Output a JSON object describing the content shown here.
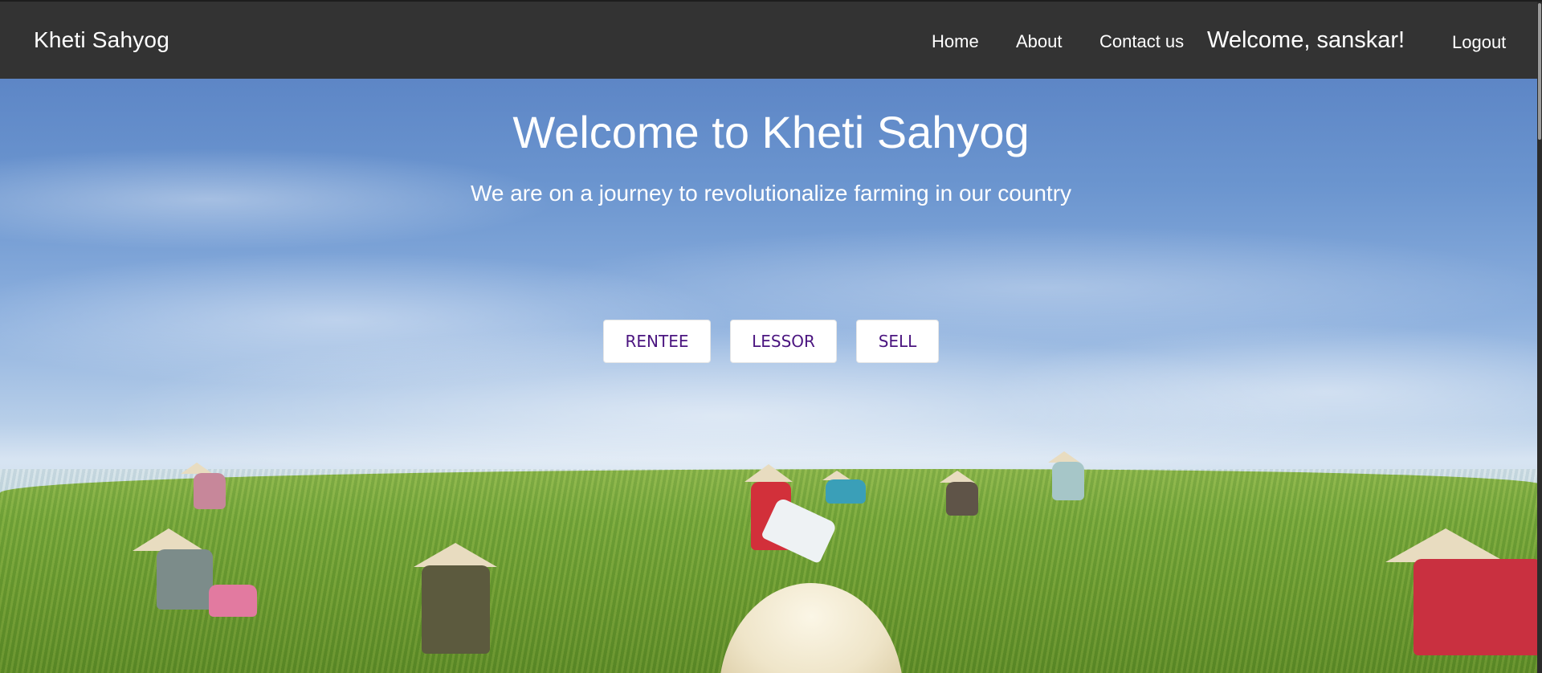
{
  "navbar": {
    "brand": "Kheti Sahyog",
    "links": {
      "home": "Home",
      "about": "About",
      "contact": "Contact us"
    },
    "welcome": "Welcome, sanskar!",
    "logout": "Logout"
  },
  "hero": {
    "title": "Welcome to Kheti Sahyog",
    "subtitle": "We are on a journey to revolutionalize farming in our country",
    "buttons": {
      "rentee": "RENTEE",
      "lessor": "LESSOR",
      "sell": "SELL"
    },
    "image_description_icon": "tea-field-workers-image"
  },
  "colors": {
    "navbar_bg": "#333333",
    "button_text": "#4b1580",
    "sky": "#5d86c6",
    "field": "#6b9a30"
  }
}
